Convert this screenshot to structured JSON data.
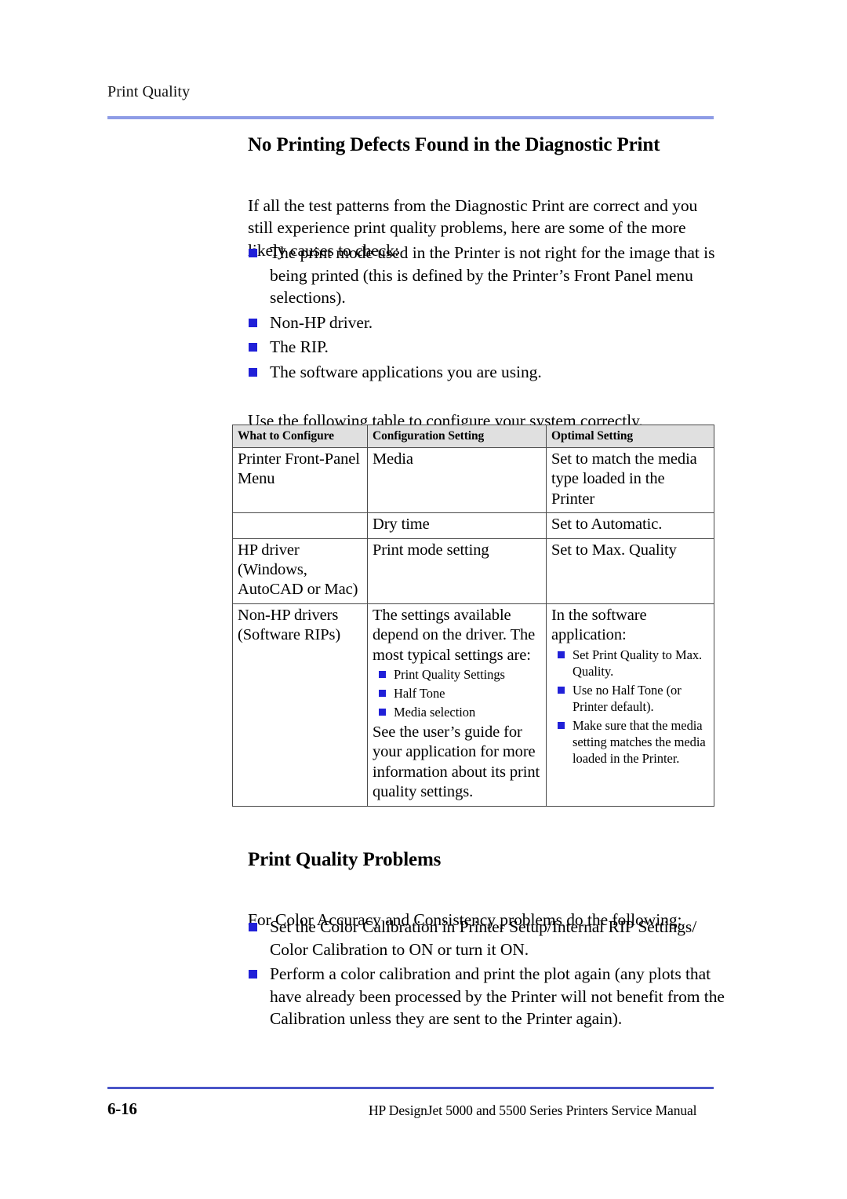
{
  "running_head": "Print Quality",
  "section": {
    "title": "No Printing Defects Found in the Diagnostic Print",
    "intro": "If all the test patterns from the Diagnostic Print are correct and you still experience print quality problems, here are some of the more likely causes to check:",
    "causes": [
      "The print mode used in the Printer is not right for the image that is being printed (this is defined by the Printer’s Front Panel menu selections).",
      "Non-HP driver.",
      "The RIP.",
      "The software applications you are using."
    ],
    "table_lead_in": "Use the following table to configure your system correctly."
  },
  "table": {
    "headers": [
      "What to Configure",
      "Configuration Setting",
      "Optimal Setting"
    ],
    "rows": [
      {
        "what": "Printer Front-Panel Menu",
        "setting": "Media",
        "optimal": "Set to match the media type loaded in the Printer"
      },
      {
        "what": "",
        "setting": "Dry time",
        "optimal": "Set to Automatic."
      },
      {
        "what": "HP driver (Windows, AutoCAD or Mac)",
        "setting": "Print mode setting",
        "optimal": "Set to Max. Quality"
      },
      {
        "what": "Non-HP drivers (Software RIPs)",
        "setting_lead": "The settings available depend on the driver. The most typical settings are:",
        "setting_bullets": [
          "Print Quality Settings",
          "Half Tone",
          "Media selection"
        ],
        "setting_tail": "See the user’s guide for your application for more information about its print quality settings.",
        "optimal_lead": "In the software application:",
        "optimal_bullets": [
          "Set Print Quality to Max. Quality.",
          "Use no Half Tone (or Printer default).",
          "Make sure that the media setting matches the media loaded in the Printer."
        ]
      }
    ]
  },
  "problems": {
    "title": "Print Quality Problems",
    "intro": "For Color Accuracy and Consistency problems do the following:",
    "steps": [
      "Set the Color Calibration in Printer Setup/Internal RIP Settings/ Color Calibration to ON or turn it ON.",
      "Perform a color calibration and print the plot again (any plots that have already been processed by the Printer will not benefit from the Calibration unless they are sent to the Printer again)."
    ]
  },
  "footer": {
    "page_number": "6-16",
    "manual_title": "HP DesignJet 5000 and 5500 Series Printers Service Manual"
  },
  "colors": {
    "bullet": "#2020d8",
    "rule_top": "#8e9ce6",
    "rule_bottom": "#4a56c8",
    "table_header_bg": "#e0e0e0"
  }
}
